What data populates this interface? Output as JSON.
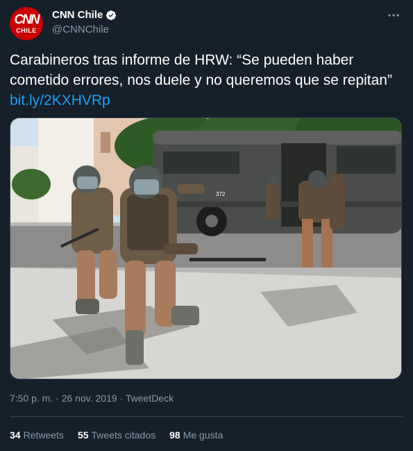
{
  "account": {
    "logo_top": "CNN",
    "logo_bottom": "CHILE",
    "display_name": "CNN Chile",
    "handle": "@CNNChile",
    "verified": true
  },
  "tweet": {
    "text": "Carabineros tras informe de HRW: “Se pueden haber cometido errores, nos duele y no queremos que se repitan”",
    "link": "bit.ly/2KXHVRp"
  },
  "media": {
    "bus_number": "372"
  },
  "meta": {
    "time": "7:50 p. m.",
    "separator": "·",
    "date": "26 nov. 2019",
    "source": "TweetDeck"
  },
  "stats": {
    "retweets_count": "34",
    "retweets_label": "Retweets",
    "quotes_count": "55",
    "quotes_label": "Tweets citados",
    "likes_count": "98",
    "likes_label": "Me gusta"
  },
  "icons": [
    "verified-badge-icon",
    "more-options-icon"
  ],
  "colors": {
    "background": "#15202b",
    "link": "#1da1f2",
    "secondary_text": "#8899a6",
    "avatar": "#cc0000"
  }
}
